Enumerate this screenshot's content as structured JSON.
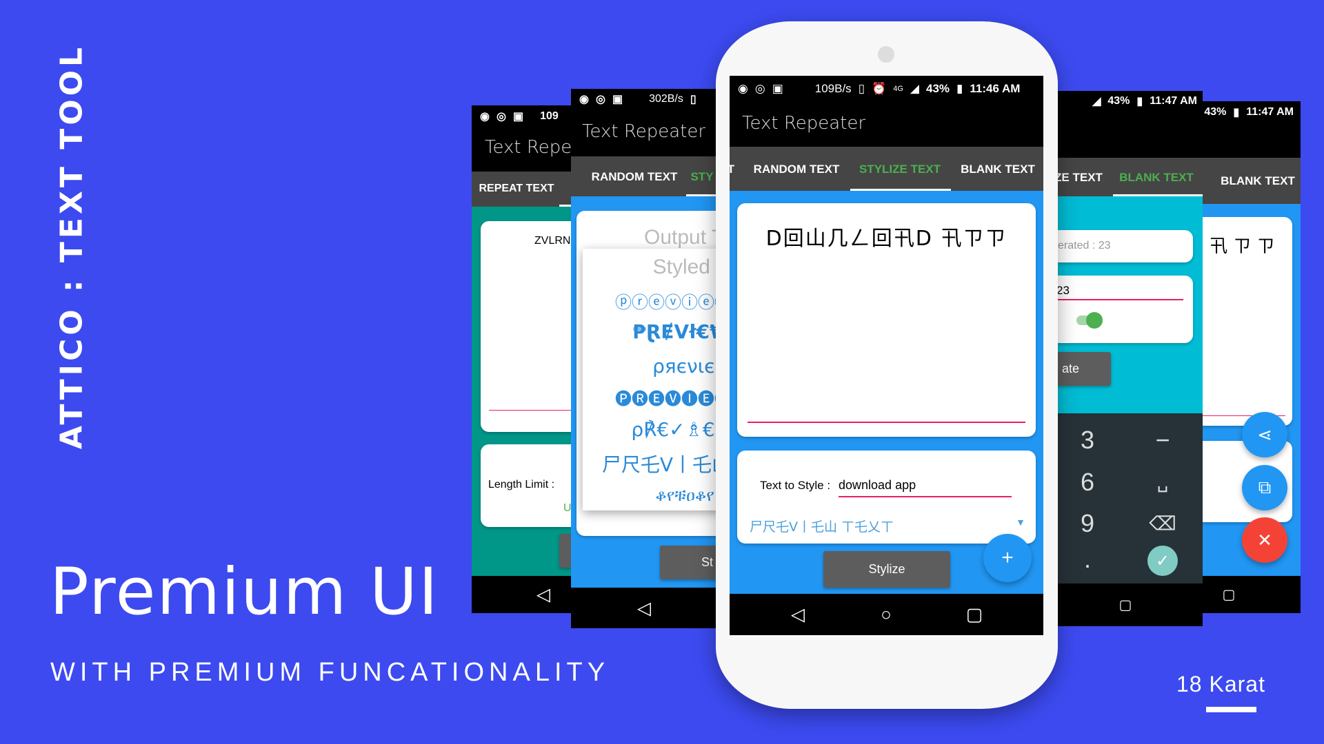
{
  "banner": {
    "vertical_title": "ATTICO : TEXT TOOL",
    "headline": "Premium UI",
    "subheadline": "WITH PREMIUM FUNCATIONALITY",
    "brand": "18 Karat"
  },
  "colors": {
    "background": "#3c4af0",
    "app_blue": "#2196f3",
    "teal": "#009688",
    "cyan": "#00bcd4",
    "active_tab": "#4caf50",
    "accent_pink": "#e91e63",
    "fab_red": "#f44336"
  },
  "app_title": "Text Repeater",
  "phone1": {
    "status_speed": "109",
    "tab": "REPEAT TEXT",
    "output": "ZVLRN",
    "length_label": "Length Limit :",
    "partial": "U"
  },
  "phone2": {
    "status_speed": "302B/s",
    "tabs": [
      "RANDOM TEXT",
      "STY"
    ],
    "output_placeholder": "Output T",
    "popup_title": "Styled R",
    "styles": [
      "ⓟⓡⓔⓥⓘⓔⓦ",
      "₱ⱤɆVł€₩",
      "ρяєνιєω",
      "🅟🅡🅔🅥🅘🅔🅦",
      "ρ℟€✓♗€ω",
      "尸尺乇V丨乇山",
      "ቆየቹዐቆየ山"
    ],
    "button": "St"
  },
  "center": {
    "status": {
      "speed": "109B/s",
      "network": "4G",
      "battery": "43%",
      "time": "11:46 AM"
    },
    "tabs": [
      "T",
      "RANDOM TEXT",
      "STYLIZE TEXT",
      "BLANK TEXT"
    ],
    "active_tab": 2,
    "output": "D回山几ㄥ回卂D 卂ㄗㄗ",
    "text_to_style_label": "Text to Style :",
    "text_to_style_value": "download app",
    "style_selected": "尸尺乇V丨乇山 ㄒ乇乂ㄒ",
    "stylize_button": "Stylize",
    "fab_icon": "plus-icon"
  },
  "phone4": {
    "status": {
      "battery": "43%",
      "time": "11:47 AM"
    },
    "tabs": [
      "ZE TEXT",
      "BLANK TEXT"
    ],
    "generated": "erated : 23",
    "input": "23",
    "toggle_on": true,
    "button": "ate",
    "keys": [
      "3",
      "6",
      "9",
      ".",
      "−",
      "␣",
      "⌫",
      "✓"
    ]
  },
  "phone5": {
    "status": {
      "battery": "43%",
      "time": "11:47 AM"
    },
    "tab": "BLANK TEXT",
    "output": "卂 ㄗ ㄗ",
    "fabs": [
      "share-icon",
      "copy-icon",
      "close-icon"
    ]
  }
}
